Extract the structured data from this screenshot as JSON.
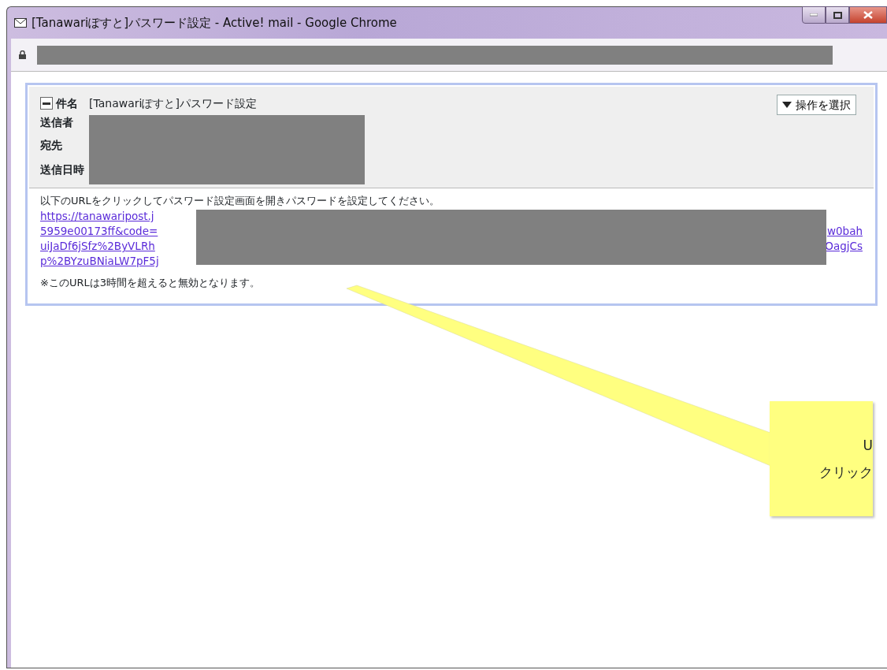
{
  "window": {
    "title": "[Tanawariぽすと]パスワード設定 - Active! mail - Google Chrome"
  },
  "mail": {
    "header": {
      "expanded": true,
      "action_label": "操作を選択",
      "fields": [
        {
          "label": "件名",
          "value": "[Tanawariぽすと]パスワード設定"
        },
        {
          "label": "送信者"
        },
        {
          "label": "宛先"
        },
        {
          "label": "送信日時"
        }
      ]
    },
    "body": {
      "intro": "以下のURLをクリックしてパスワード設定画面を開きパスワードを設定してください。",
      "link_lines": [
        {
          "left": "https://tanawaripost.j"
        },
        {
          "left": "5959e00173ff&code=",
          "right": "w0bah"
        },
        {
          "left": "uiJaDf6jSfz%2ByVLRh",
          "right": "OagjCs"
        },
        {
          "left": "p%2BYzuBNiaLW7pF5j"
        }
      ],
      "note": "※このURLは3時間を超えると無効となります。"
    }
  },
  "callout": {
    "lines": [
      "U",
      "クリック"
    ]
  }
}
